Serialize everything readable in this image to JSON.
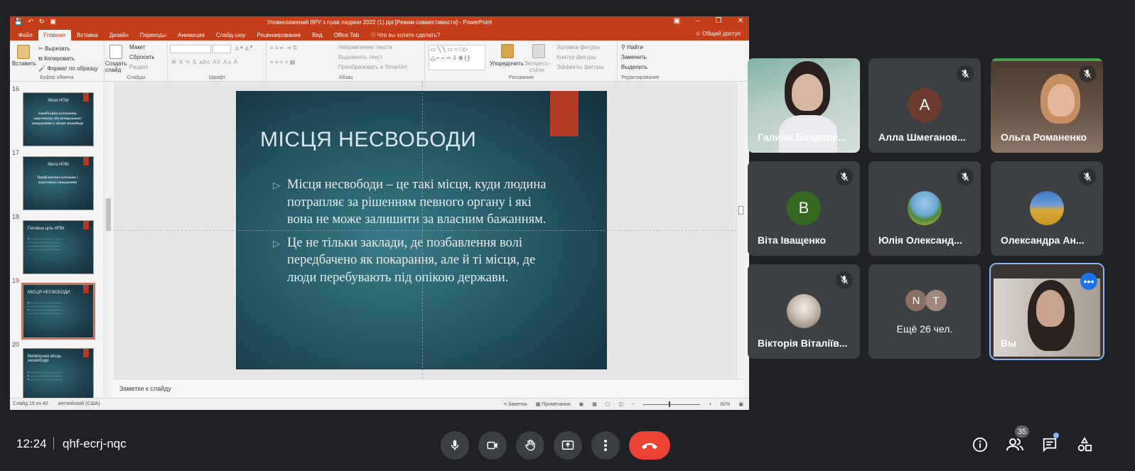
{
  "powerpoint": {
    "window_title": "Уповноважений ВРУ з прав людини 2022 (1).ppt [Режим совместимости] - PowerPoint",
    "tabs": [
      "Файл",
      "Главная",
      "Вставка",
      "Дизайн",
      "Переходы",
      "Анимация",
      "Слайд-шоу",
      "Рецензирование",
      "Вид",
      "Office Tab"
    ],
    "active_tab": "Главная",
    "tell_me": "Что вы хотите сделать?",
    "share": "Общий доступ",
    "ribbon": {
      "paste": "Вставить",
      "cut": "Вырезать",
      "copy": "Копировать",
      "format_painter": "Формат по образцу",
      "clipboard_group": "Буфер обмена",
      "new_slide": "Создать слайд",
      "layout": "Макет",
      "reset": "Сбросить",
      "section": "Раздел",
      "slides_group": "Слайды",
      "font_group": "Шрифт",
      "font_buttons": "Ж К Ч S abc AV Aa A",
      "text_direction": "Направление текста",
      "align_text": "Выровнять текст",
      "convert_smartart": "Преобразовать в SmartArt",
      "paragraph_group": "Абзац",
      "arrange": "Упорядочить",
      "quick_styles": "Экспресс-стили",
      "shape_fill": "Заливка фигуры",
      "shape_outline": "Контур фигуры",
      "shape_effects": "Эффекты фигуры",
      "drawing_group": "Рисование",
      "find": "Найти",
      "replace": "Заменить",
      "select": "Выделить",
      "editing_group": "Редактирование"
    },
    "thumbnails": [
      {
        "num": "16",
        "title": "Місія НПМ",
        "body": "Запобігання катуванню, жорстокому або нелюдському поводженню в місцях несвободи"
      },
      {
        "num": "17",
        "title": "Мета НПМ",
        "body": "Профілактика катувань і жорстокого поводження"
      },
      {
        "num": "18",
        "title": "Головна ціль НПМ",
        "body": ""
      },
      {
        "num": "19",
        "title": "МІСЦЯ НЕСВОБОДИ",
        "body": ""
      },
      {
        "num": "20",
        "title": "Виявлення місць несвободи",
        "body": ""
      }
    ],
    "slide": {
      "title": "МІСЦЯ НЕСВОБОДИ",
      "bullets": [
        "Місця несвободи – це такі місця, куди людина потрапляє за  рішенням певного органу і які вона не може залишити за власним бажанням.",
        "Це не тільки заклади, де позбавлення волі передбачено як покарання, але й ті місця, де люди перебувають під опікою держави."
      ]
    },
    "notes_placeholder": "Заметки к слайду",
    "status": {
      "slide_counter": "Слайд 19 из 40",
      "language": "английский (США)",
      "notes_btn": "Заметки",
      "comments_btn": "Примечания",
      "zoom": "82%"
    }
  },
  "participants": [
    {
      "name": "Галина Бондаре...",
      "type": "video",
      "muted": false
    },
    {
      "name": "Алла Шмеганов...",
      "type": "avatar",
      "initial": "A",
      "color": "#6d3a2e",
      "muted": true
    },
    {
      "name": "Ольга Романенко",
      "type": "video",
      "muted": true
    },
    {
      "name": "Віта Іващенко",
      "type": "avatar",
      "initial": "B",
      "color": "#33691e",
      "muted": true
    },
    {
      "name": "Юлія Олександ...",
      "type": "photo",
      "muted": true
    },
    {
      "name": "Олександра Ан...",
      "type": "photo",
      "muted": true
    },
    {
      "name": "Вікторія Віталіїв...",
      "type": "photo",
      "muted": true
    },
    {
      "name": "Ещё 26 чел.",
      "type": "more",
      "initials": [
        "N",
        "T"
      ]
    },
    {
      "name": "Вы",
      "type": "video",
      "self": true
    }
  ],
  "meeting": {
    "time": "12:24",
    "code": "qhf-ecrj-nqc",
    "participant_count": "35"
  },
  "colors": {
    "accent": "#c43e1c",
    "end_call": "#ea4335",
    "self_outline": "#8ab4f8"
  }
}
